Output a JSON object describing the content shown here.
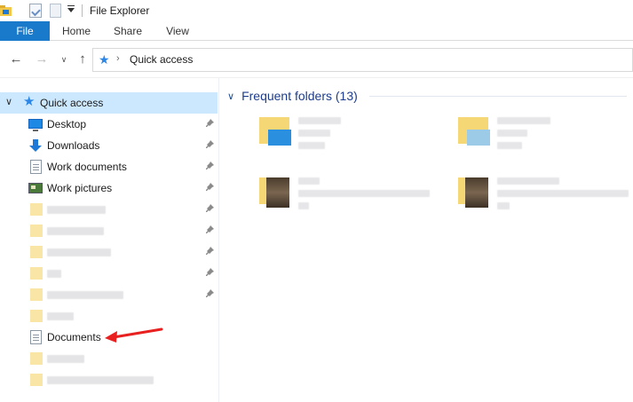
{
  "window": {
    "title": "File Explorer"
  },
  "ribbon": {
    "tabs": [
      "File",
      "Home",
      "Share",
      "View"
    ],
    "active_color": "#1979ca"
  },
  "address": {
    "path": "Quick access"
  },
  "nav_pane": {
    "root": {
      "label": "Quick access",
      "expanded": true,
      "selected_color": "#cce8ff"
    },
    "items": [
      {
        "label": "Desktop",
        "icon": "desktop-icon",
        "pinned": true
      },
      {
        "label": "Downloads",
        "icon": "download-arrow-icon",
        "pinned": true
      },
      {
        "label": "Work documents",
        "icon": "document-icon",
        "pinned": true
      },
      {
        "label": "Work pictures",
        "icon": "picture-icon",
        "pinned": true
      },
      {
        "label": "",
        "icon": "folder-icon",
        "pinned": true,
        "blurred": true
      },
      {
        "label": "",
        "icon": "folder-icon",
        "pinned": true,
        "blurred": true
      },
      {
        "label": "",
        "icon": "folder-icon",
        "pinned": true,
        "blurred": true
      },
      {
        "label": "",
        "icon": "folder-icon",
        "pinned": true,
        "blurred": true
      },
      {
        "label": "",
        "icon": "folder-icon",
        "pinned": true,
        "blurred": true
      },
      {
        "label": "",
        "icon": "folder-icon",
        "pinned": false,
        "blurred": true
      },
      {
        "label": "Documents",
        "icon": "document-icon",
        "pinned": false,
        "highlighted_by_arrow": true
      },
      {
        "label": "",
        "icon": "folder-icon",
        "pinned": false,
        "blurred": true
      },
      {
        "label": "",
        "icon": "folder-icon",
        "pinned": false,
        "blurred": true
      }
    ]
  },
  "content": {
    "group_title": "Frequent folders (13)",
    "tiles": [
      {
        "icon": "folder-desktop-icon",
        "blurred": true
      },
      {
        "icon": "folder-downloads-icon",
        "blurred": true
      },
      {
        "icon": "folder-photo-icon",
        "blurred": true
      },
      {
        "icon": "folder-photo-icon",
        "blurred": true
      }
    ]
  },
  "annotation": {
    "type": "arrow",
    "color": "#e8201f",
    "points_to": "Documents"
  }
}
